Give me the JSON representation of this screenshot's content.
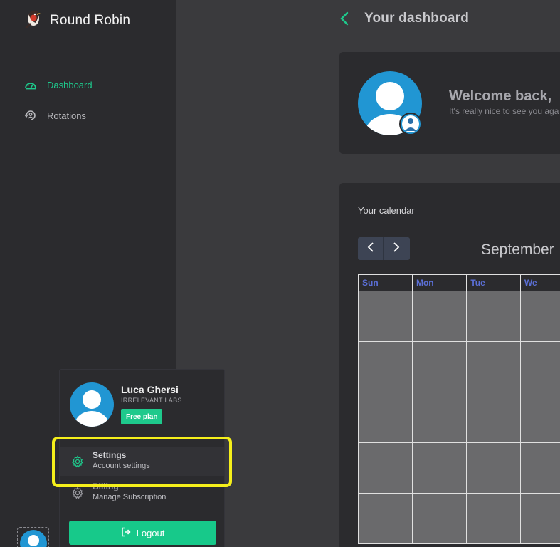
{
  "app": {
    "title": "Round Robin"
  },
  "sidebar": {
    "items": [
      {
        "label": "Dashboard",
        "icon": "gauge-icon",
        "active": true
      },
      {
        "label": "Rotations",
        "icon": "rotation-icon",
        "active": false
      }
    ]
  },
  "header": {
    "title": "Your dashboard"
  },
  "welcome": {
    "heading": "Welcome back,",
    "subtitle": "It's really nice to see you aga"
  },
  "calendar": {
    "label": "Your calendar",
    "month": "September",
    "weekdays": [
      "Sun",
      "Mon",
      "Tue",
      "We"
    ]
  },
  "user_menu": {
    "name": "Luca Ghersi",
    "organization": "IRRELEVANT LABS",
    "plan_badge": "Free plan",
    "items": [
      {
        "title": "Settings",
        "subtitle": "Account settings",
        "icon": "gear-icon"
      },
      {
        "title": "Billing",
        "subtitle": "Manage Subscription",
        "icon": "gear-icon"
      }
    ],
    "logout_label": "Logout"
  },
  "colors": {
    "accent": "#1ec98c",
    "highlight": "#f5ef1b",
    "weekday_text": "#5b6fd6",
    "avatar_blue": "#2196d3"
  }
}
